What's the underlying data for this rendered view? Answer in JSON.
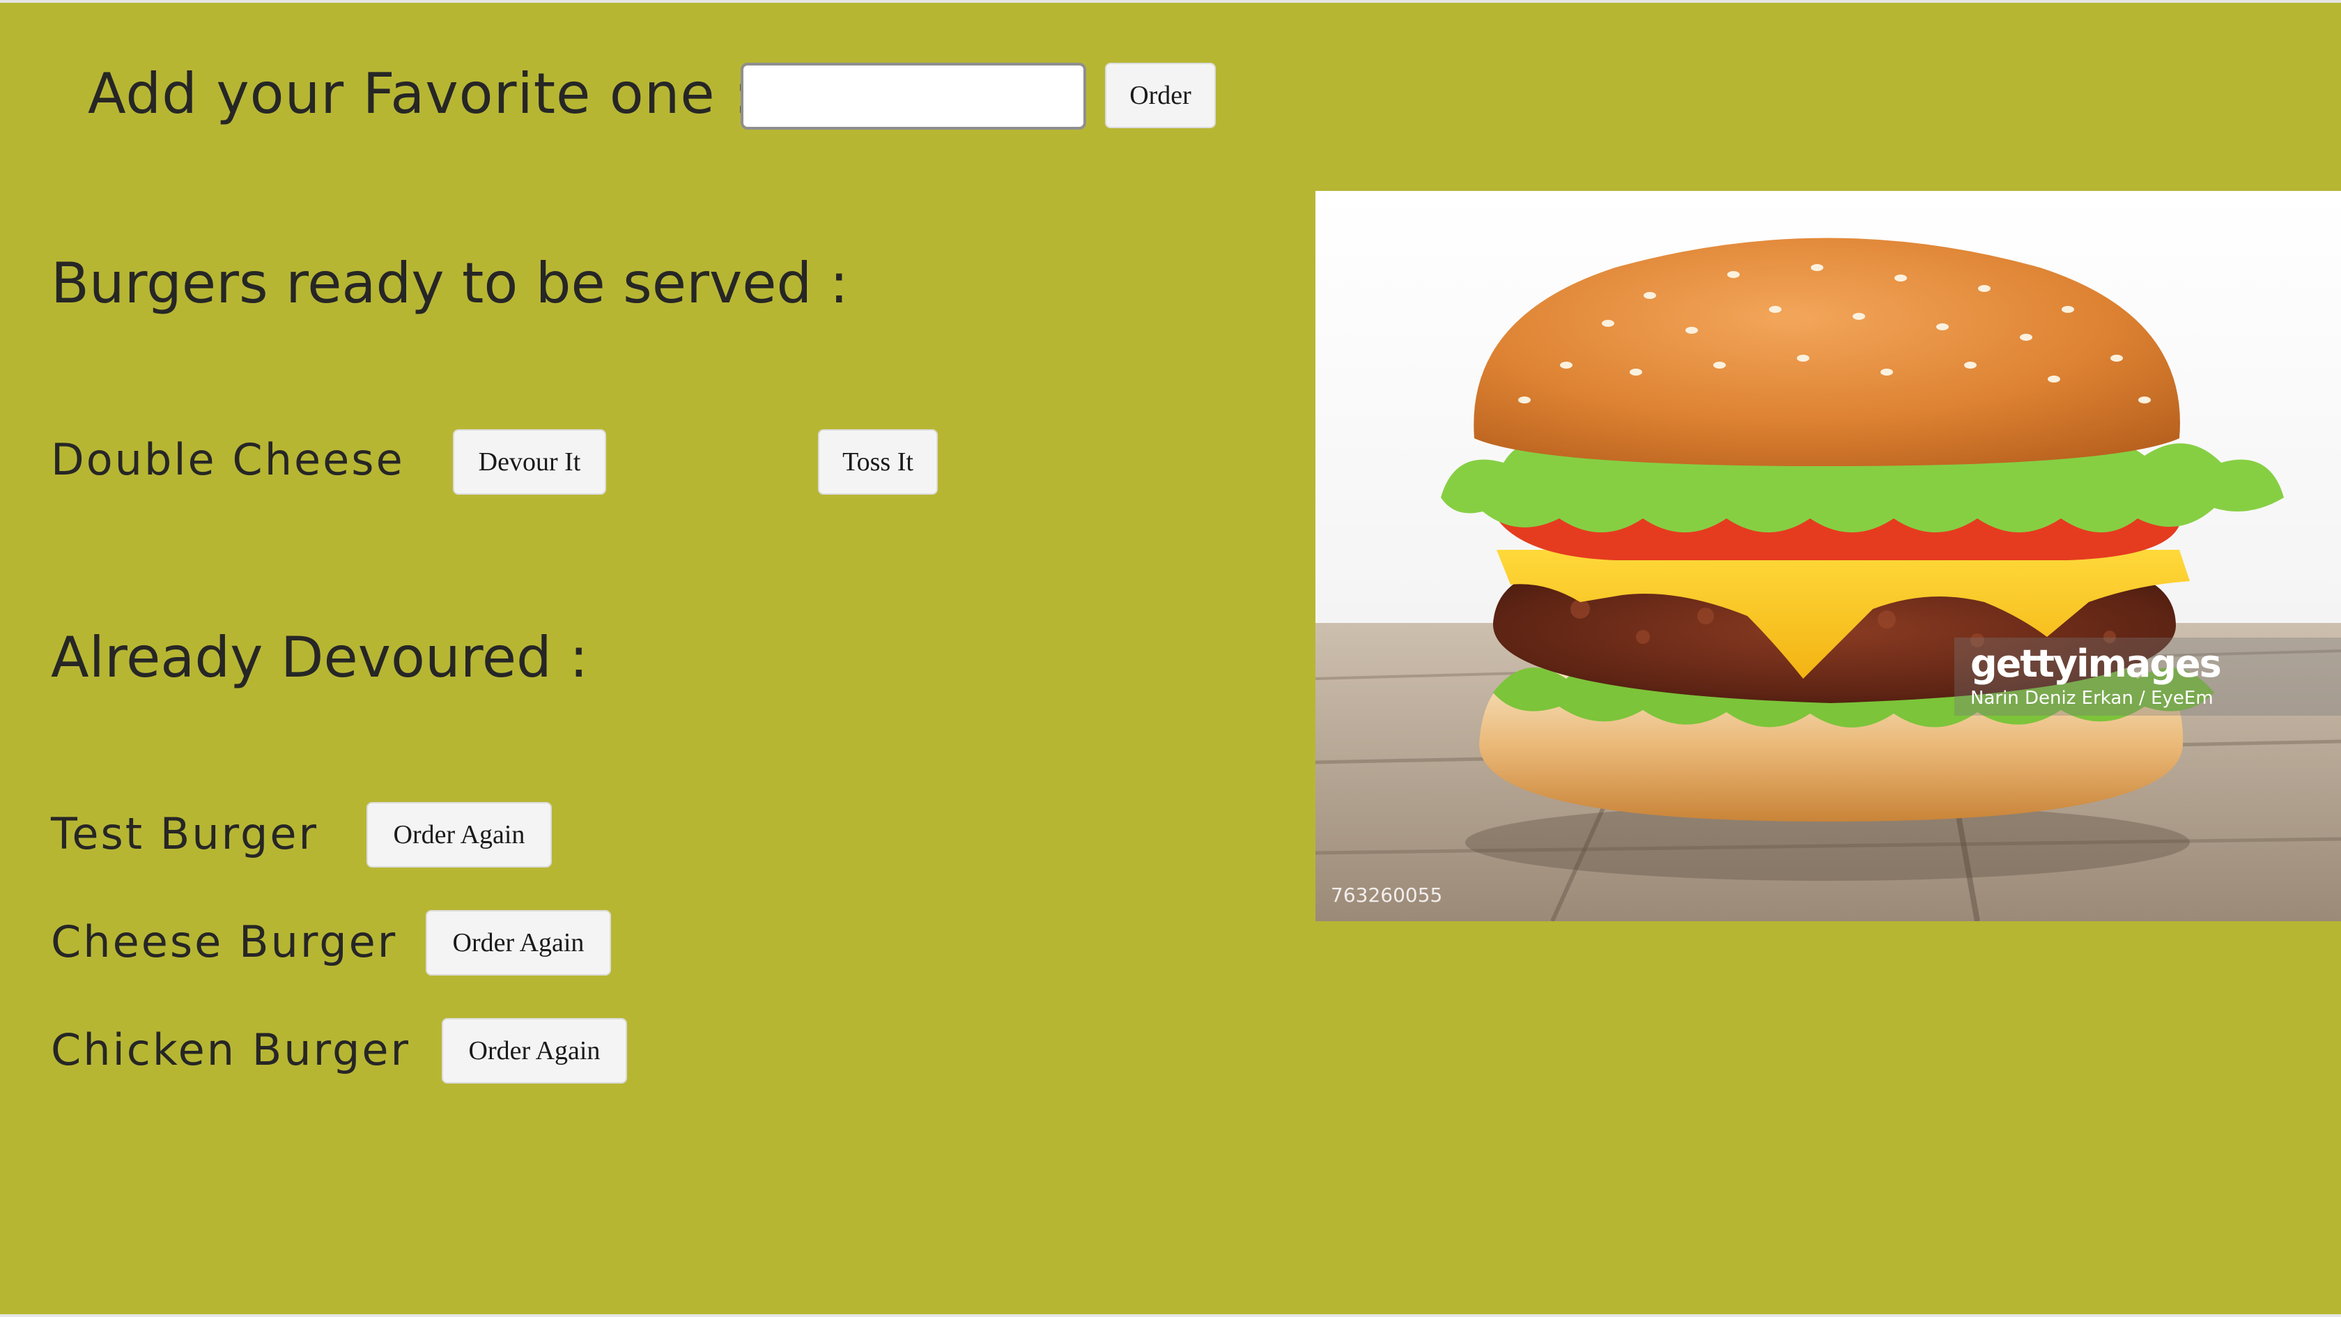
{
  "add_form": {
    "heading": "Add your Favorite one :",
    "input_value": "",
    "input_placeholder": "",
    "order_label": "Order"
  },
  "ready_section": {
    "heading": "Burgers ready to be served :",
    "items": [
      {
        "name": "Double Cheese",
        "devour_label": "Devour It",
        "toss_label": "Toss It"
      }
    ]
  },
  "devoured_section": {
    "heading": "Already Devoured :",
    "items": [
      {
        "name": "Test Burger",
        "button_label": "Order Again"
      },
      {
        "name": "Cheese Burger",
        "button_label": "Order Again"
      },
      {
        "name": "Chicken Burger",
        "button_label": "Order Again"
      }
    ]
  },
  "photo": {
    "watermark_brand": "gettyimages",
    "watermark_credit": "Narin Deniz Erkan / EyeEm",
    "image_id": "763260055"
  },
  "colors": {
    "background": "#b7b633",
    "button_bg": "#f4f4f4",
    "text": "#262626"
  }
}
